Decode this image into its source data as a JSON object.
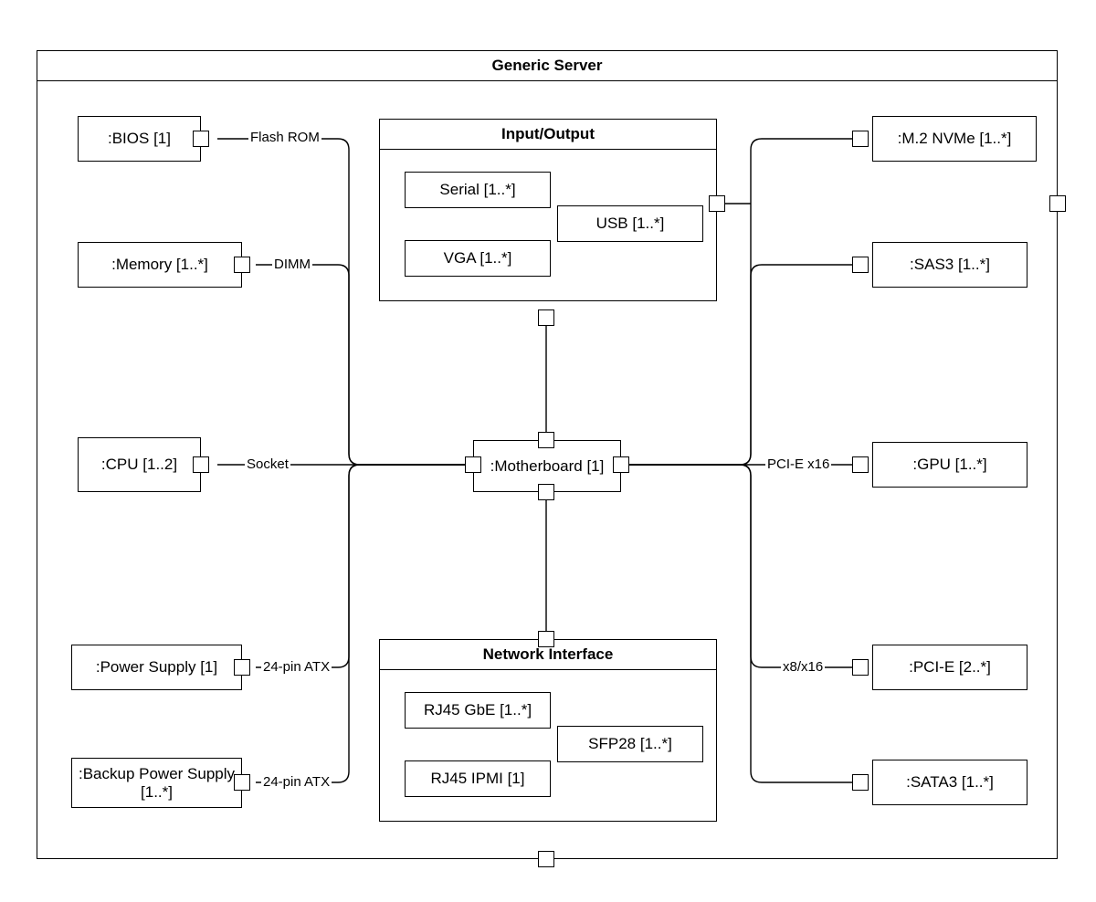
{
  "container": {
    "title": "Generic Server"
  },
  "motherboard": {
    "label": ":Motherboard [1]"
  },
  "io": {
    "title": "Input/Output",
    "serial": "Serial [1..*]",
    "usb": "USB [1..*]",
    "vga": "VGA [1..*]"
  },
  "net": {
    "title": "Network Interface",
    "rj45gbe": "RJ45 GbE [1..*]",
    "sfp28": "SFP28 [1..*]",
    "rj45ipmi": "RJ45 IPMI [1]"
  },
  "left": {
    "bios": {
      "label": ":BIOS [1]",
      "edge": "Flash ROM"
    },
    "memory": {
      "label": ":Memory [1..*]",
      "edge": "DIMM"
    },
    "cpu": {
      "label": ":CPU [1..2]",
      "edge": "Socket"
    },
    "psu": {
      "label": ":Power Supply [1]",
      "edge": "24-pin ATX"
    },
    "bpsu": {
      "label": ":Backup Power Supply [1..*]",
      "edge": "24-pin ATX"
    }
  },
  "right": {
    "m2": {
      "label": ":M.2 NVMe [1..*]"
    },
    "sas3": {
      "label": ":SAS3 [1..*]"
    },
    "gpu": {
      "label": ":GPU [1..*]",
      "edge": "PCI-E x16"
    },
    "pcie": {
      "label": ":PCI-E [2..*]",
      "edge": "x8/x16"
    },
    "sata3": {
      "label": ":SATA3 [1..*]"
    }
  }
}
